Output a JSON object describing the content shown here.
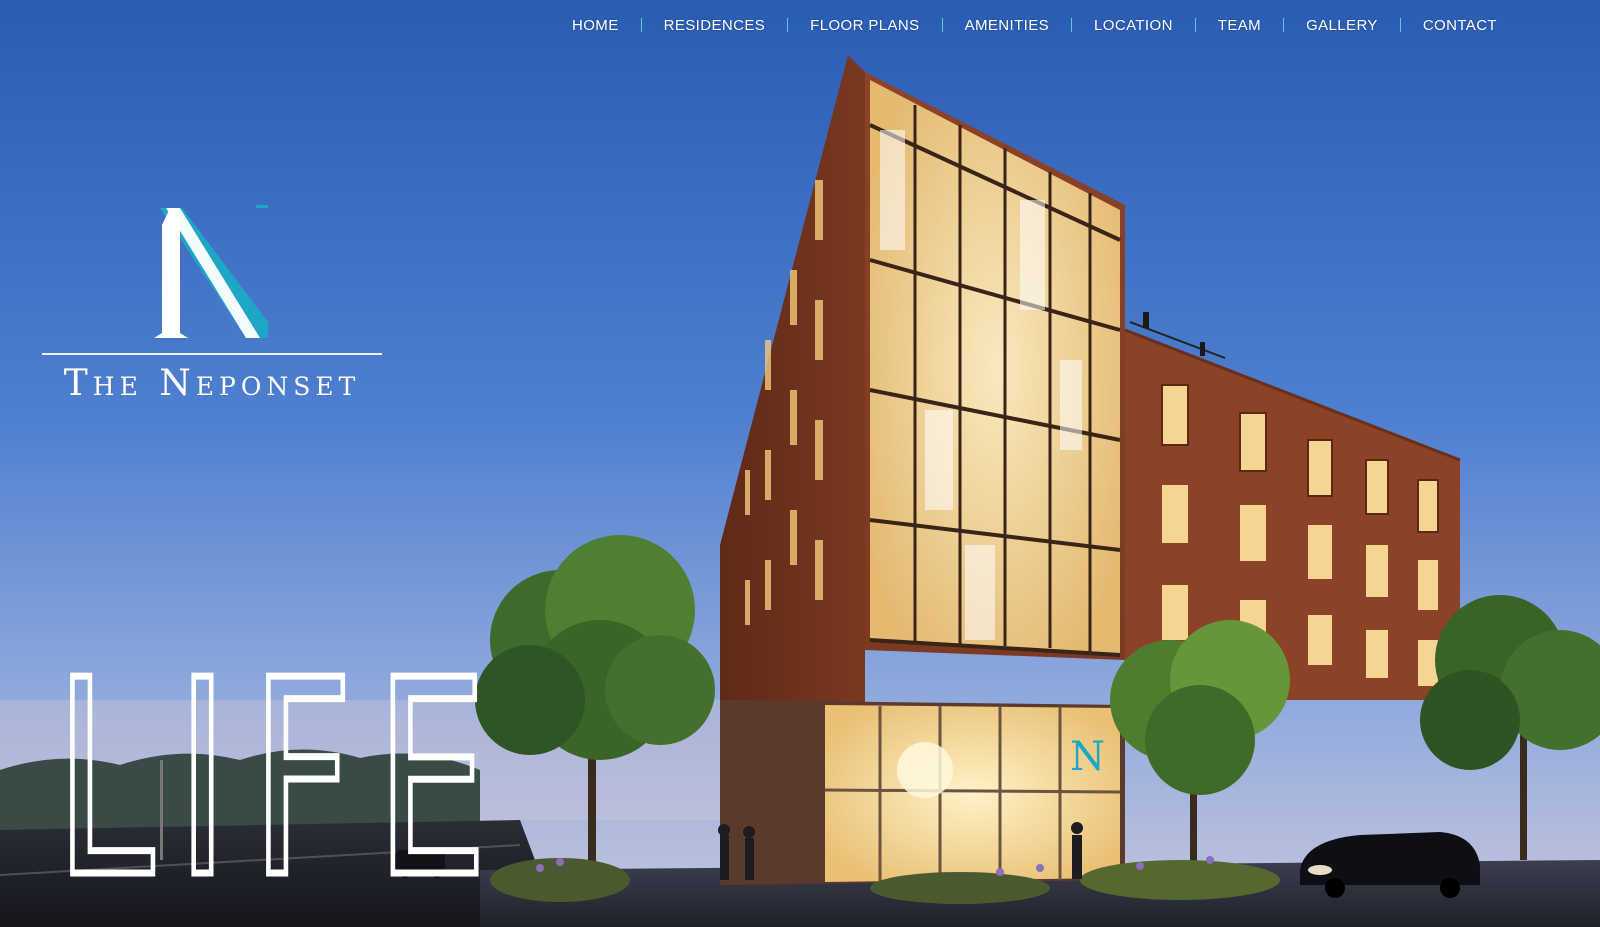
{
  "nav": {
    "items": [
      {
        "label": "HOME"
      },
      {
        "label": "RESIDENCES"
      },
      {
        "label": "FLOOR PLANS"
      },
      {
        "label": "AMENITIES"
      },
      {
        "label": "LOCATION"
      },
      {
        "label": "TEAM"
      },
      {
        "label": "GALLERY"
      },
      {
        "label": "CONTACT"
      }
    ],
    "separator_color": "#6fd3dd"
  },
  "logo": {
    "monogram": "N",
    "name": "The Neponset",
    "monogram_colors": [
      "#ffffff",
      "#1ea6c6"
    ]
  },
  "hero": {
    "headline": "LIFE",
    "sign_letter": "N"
  },
  "colors": {
    "sky_top": "#2b5fb6",
    "sky_bottom": "#b7c6e6",
    "brick": "#8a3f24",
    "window_glow": "#f6d592",
    "accent": "#1ea6c6"
  }
}
